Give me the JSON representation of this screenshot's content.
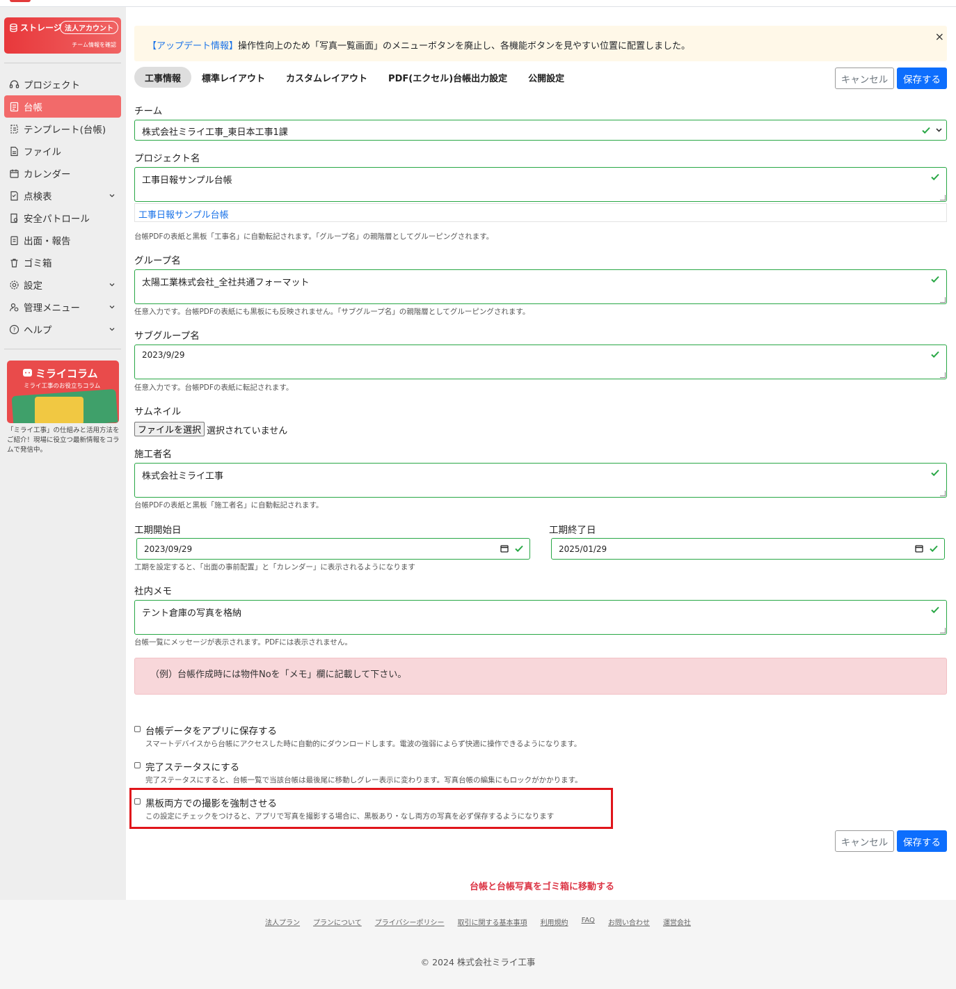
{
  "sidebar": {
    "storage": {
      "title": "ストレージ",
      "badge": "法人アカウント",
      "sub": "チーム情報を確認"
    },
    "items": [
      {
        "label": "プロジェクト",
        "icon": "headset-icon"
      },
      {
        "label": "台帳",
        "icon": "ledger-icon"
      },
      {
        "label": "テンプレート(台帳)",
        "icon": "template-icon"
      },
      {
        "label": "ファイル",
        "icon": "file-icon"
      },
      {
        "label": "カレンダー",
        "icon": "calendar-icon"
      },
      {
        "label": "点検表",
        "icon": "checklist-icon"
      },
      {
        "label": "安全パトロール",
        "icon": "patrol-icon"
      },
      {
        "label": "出面・報告",
        "icon": "report-icon"
      },
      {
        "label": "ゴミ箱",
        "icon": "trash-icon"
      },
      {
        "label": "設定",
        "icon": "gear-icon"
      },
      {
        "label": "管理メニュー",
        "icon": "admin-icon"
      },
      {
        "label": "ヘルプ",
        "icon": "help-icon"
      }
    ],
    "column": {
      "title": "ミライコラム",
      "subtitle": "ミライ工事のお役立ちコラム",
      "description": "「ミライ工事」の仕組みと活用方法をご紹介！現場に役立つ最新情報をコラムで発信中。"
    }
  },
  "notice": {
    "link": "【アップデート情報】",
    "text": "操作性向上のため「写真一覧画面」のメニューボタンを廃止し、各機能ボタンを見やすい位置に配置しました。",
    "close": "×"
  },
  "tabs": [
    "工事情報",
    "標準レイアウト",
    "カスタムレイアウト",
    "PDF(エクセル)台帳出力設定",
    "公開設定"
  ],
  "buttons": {
    "cancel": "キャンセル",
    "save": "保存する"
  },
  "form": {
    "team": {
      "label": "チーム",
      "value": "株式会社ミライ工事_東日本工事1課"
    },
    "project": {
      "label": "プロジェクト名",
      "value": "工事日報サンプル台帳",
      "suggestion": "工事日報サンプル台帳",
      "hint": "台帳PDFの表紙と黒板「工事名」に自動転記されます。「グループ名」の親階層としてグルーピングされます。"
    },
    "group": {
      "label": "グループ名",
      "value": "太陽工業株式会社_全社共通フォーマット",
      "hint": "任意入力です。台帳PDFの表紙にも黒板にも反映されません。「サブグループ名」の親階層としてグルーピングされます。"
    },
    "subgroup": {
      "label": "サブグループ名",
      "value": "2023/9/29",
      "hint": "任意入力です。台帳PDFの表紙に転記されます。"
    },
    "thumbnail": {
      "label": "サムネイル",
      "button": "ファイルを選択",
      "status": "選択されていません"
    },
    "contractor": {
      "label": "施工者名",
      "value": "株式会社ミライ工事",
      "hint": "台帳PDFの表紙と黒板「施工者名」に自動転記されます。"
    },
    "start": {
      "label": "工期開始日",
      "value": "2023/09/29"
    },
    "end": {
      "label": "工期終了日",
      "value": "2025/01/29"
    },
    "period_hint": "工期を設定すると、「出面の事前配置」と「カレンダー」に表示されるようになります",
    "memo": {
      "label": "社内メモ",
      "value": "テント倉庫の写真を格納",
      "hint": "台帳一覧にメッセージが表示されます。PDFには表示されません。",
      "alert": "（例）台帳作成時には物件Noを「メモ」欄に記載して下さい。"
    },
    "options": [
      {
        "label": "台帳データをアプリに保存する",
        "desc": "スマートデバイスから台帳にアクセスした時に自動的にダウンロードします。電波の強弱によらず快適に操作できるようになります。",
        "checked": false
      },
      {
        "label": "完了ステータスにする",
        "desc": "完了ステータスにすると、台帳一覧で当該台帳は最後尾に移動しグレー表示に変わります。写真台帳の編集にもロックがかかります。",
        "checked": false
      },
      {
        "label": "黒板両方での撮影を強制させる",
        "desc": "この設定にチェックをつけると、アプリで写真を撮影する場合に、黒板あり・なし両方の写真を必ず保存するようになります",
        "checked": false
      }
    ]
  },
  "trash_link": "台帳と台帳写真をゴミ箱に移動する",
  "footer": {
    "links": [
      "法人プラン",
      "プランについて",
      "プライバシーポリシー",
      "取引に関する基本事項",
      "利用規約",
      "FAQ",
      "お問い合わせ",
      "運営会社"
    ],
    "copyright": "© 2024 株式会社ミライ工事"
  },
  "colors": {
    "accent": "#f26a6a",
    "primary": "#0d6efd",
    "valid": "#28a745",
    "danger": "#dc3545",
    "highlight": "#e0151b"
  }
}
